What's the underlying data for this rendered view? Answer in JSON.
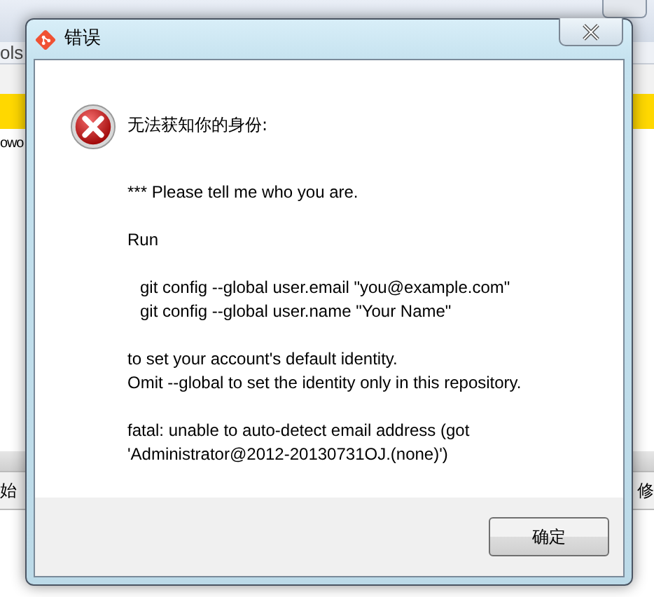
{
  "background_app": {
    "tab_label": "ols",
    "row_text": "owo",
    "footer_left": "始",
    "footer_right": "修"
  },
  "dialog": {
    "title": "错误",
    "heading": "无法获知你的身份:",
    "paragraphs": [
      {
        "kind": "text",
        "lines": [
          "*** Please tell me who you are."
        ]
      },
      {
        "kind": "text",
        "lines": [
          "Run"
        ]
      },
      {
        "kind": "command",
        "lines": [
          "git config --global user.email \"you@example.com\"",
          "git config --global user.name \"Your Name\""
        ]
      },
      {
        "kind": "text",
        "lines": [
          "to set your account's default identity.",
          "Omit --global to set the identity only in this repository."
        ]
      },
      {
        "kind": "text",
        "lines": [
          "fatal: unable to auto-detect email address (got",
          "'Administrator@2012-20130731OJ.(none)')"
        ]
      }
    ],
    "buttons": [
      "确定"
    ]
  }
}
